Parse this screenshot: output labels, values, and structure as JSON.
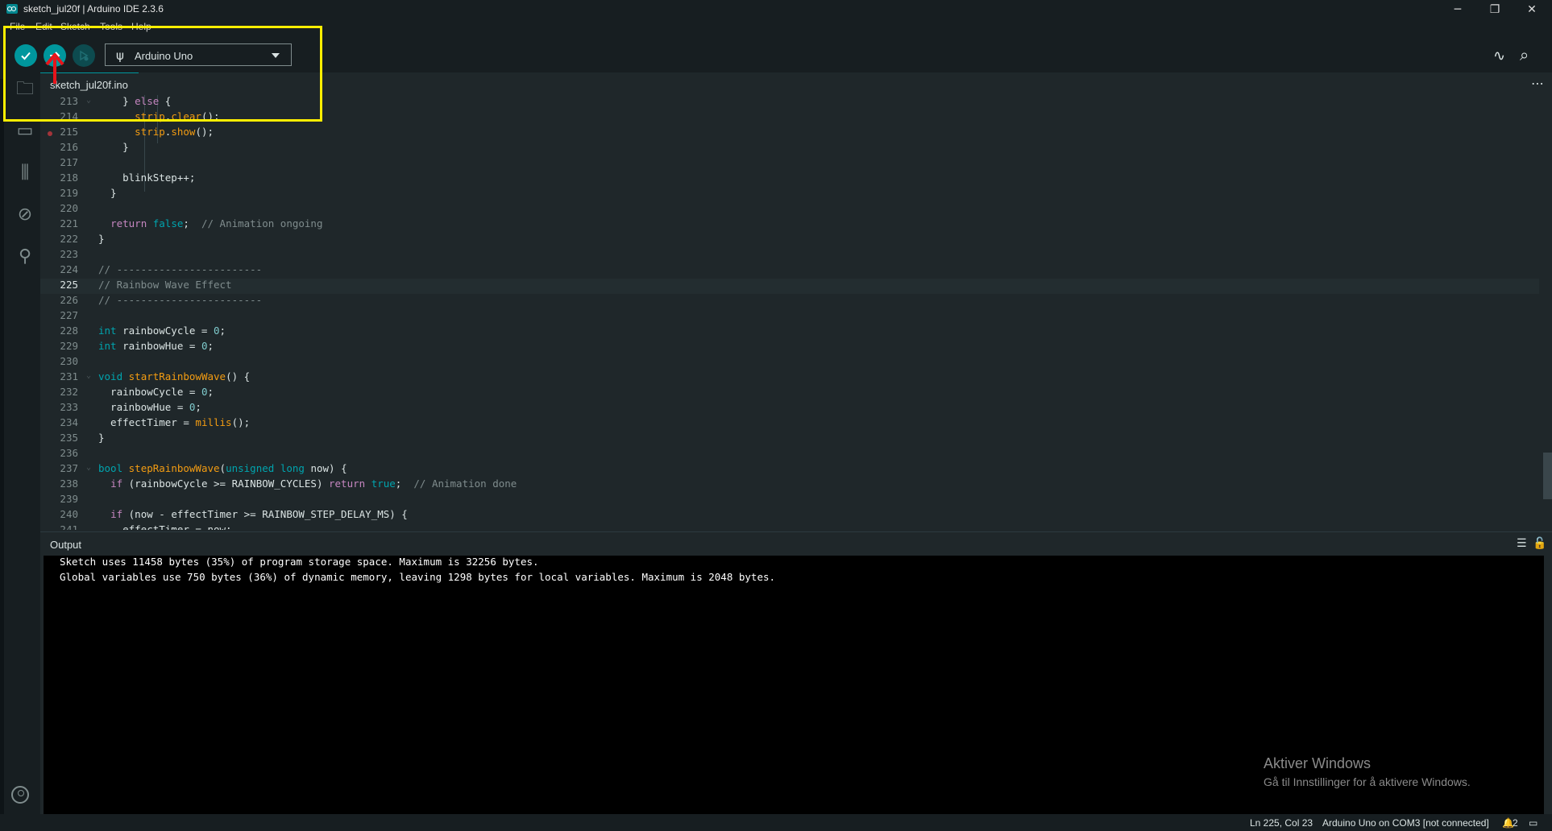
{
  "window": {
    "title": "sketch_jul20f | Arduino IDE 2.3.6",
    "minimize": "─",
    "maximize": "❐",
    "close": "✕"
  },
  "menu": {
    "file": "File",
    "edit": "Edit",
    "sketch": "Sketch",
    "tools": "Tools",
    "help": "Help"
  },
  "toolbar": {
    "board": "Arduino Uno",
    "verify_icon": "check-icon",
    "upload_icon": "arrow-right-icon",
    "debug_icon": "debug-icon"
  },
  "tab": {
    "label": "sketch_jul20f.ino"
  },
  "editor": {
    "lines": [
      {
        "n": "213"
      },
      {
        "n": "214"
      },
      {
        "n": "215"
      },
      {
        "n": "216"
      },
      {
        "n": "217"
      },
      {
        "n": "218"
      },
      {
        "n": "219"
      },
      {
        "n": "220"
      },
      {
        "n": "221"
      },
      {
        "n": "222"
      },
      {
        "n": "223"
      },
      {
        "n": "224"
      },
      {
        "n": "225"
      },
      {
        "n": "226"
      },
      {
        "n": "227"
      },
      {
        "n": "228"
      },
      {
        "n": "229"
      },
      {
        "n": "230"
      },
      {
        "n": "231"
      },
      {
        "n": "232"
      },
      {
        "n": "233"
      },
      {
        "n": "234"
      },
      {
        "n": "235"
      },
      {
        "n": "236"
      },
      {
        "n": "237"
      },
      {
        "n": "238"
      },
      {
        "n": "239"
      },
      {
        "n": "240"
      },
      {
        "n": "241"
      }
    ],
    "current_line": "225"
  },
  "output": {
    "title": "Output",
    "lines": [
      "Sketch uses 11458 bytes (35%) of program storage space. Maximum is 32256 bytes.",
      "Global variables use 750 bytes (36%) of dynamic memory, leaving 1298 bytes for local variables. Maximum is 2048 bytes."
    ]
  },
  "watermark": {
    "title": "Aktiver Windows",
    "subtitle": "Gå til Innstillinger for å aktivere Windows."
  },
  "status": {
    "position": "Ln 225, Col 23",
    "board": "Arduino Uno on COM3 [not connected]",
    "notifications": "2"
  },
  "colors": {
    "accent": "#00979d",
    "highlight": "#ffee00",
    "arrow": "#e8141b"
  }
}
